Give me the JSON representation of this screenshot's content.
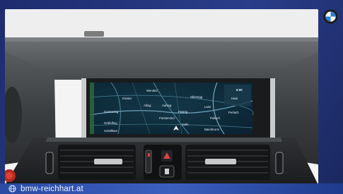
{
  "watermark": {
    "site": "bmw-reichhart.at"
  },
  "brand": {
    "logo": "bmw-roundel-logo"
  },
  "navigation_screen": {
    "clock": "6:00",
    "places": [
      "Wenden",
      "Ollenegg",
      "Alling",
      "Aubing",
      "Pasing",
      "Laim",
      "Germering",
      "Fürstenried",
      "Pullach",
      "Perlach",
      "Solln",
      "Gräfelfing",
      "Kloster",
      "Haar",
      "Baierbrunn",
      "Schäftlarn"
    ]
  },
  "colors": {
    "background": "#223479",
    "bar": "#3456b0",
    "screen": "#0d2b3c"
  }
}
